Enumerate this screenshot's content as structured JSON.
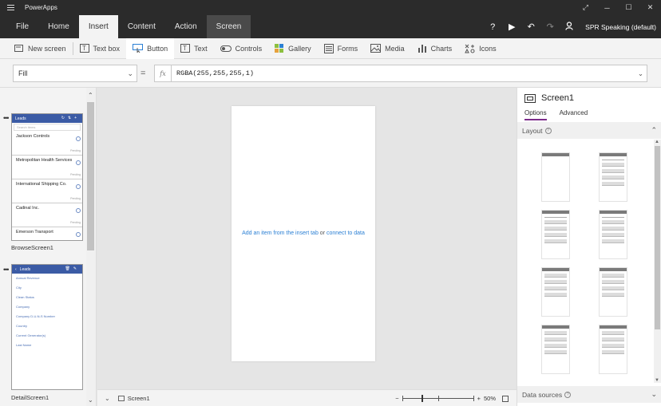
{
  "app": {
    "title": "PowerApps"
  },
  "menu": {
    "tabs": [
      "File",
      "Home",
      "Insert",
      "Content",
      "Action",
      "Screen"
    ],
    "active_tab": "Insert",
    "user": "SPR Speaking (default)"
  },
  "ribbon": {
    "buttons": [
      {
        "label": "New screen",
        "icon": "new-screen-icon"
      },
      {
        "label": "Text box",
        "icon": "text-box-icon"
      },
      {
        "label": "Button",
        "icon": "button-icon"
      },
      {
        "label": "Text",
        "icon": "text-icon"
      },
      {
        "label": "Controls",
        "icon": "toggle-icon"
      },
      {
        "label": "Gallery",
        "icon": "gallery-icon"
      },
      {
        "label": "Forms",
        "icon": "forms-icon"
      },
      {
        "label": "Media",
        "icon": "media-icon"
      },
      {
        "label": "Charts",
        "icon": "charts-icon"
      },
      {
        "label": "Icons",
        "icon": "icons-icon"
      }
    ]
  },
  "formula_bar": {
    "property": "Fill",
    "fx": "fx",
    "equals": "=",
    "formula": "RGBA(255,255,255,1)"
  },
  "screens": {
    "browse": {
      "title": "Leads",
      "search_placeholder": "Search items",
      "rows": [
        "Jackson Controls",
        "Metropolitan Health Services",
        "International Shipping Co.",
        "Cadinal Inc.",
        "Emerson Transport"
      ],
      "status": "Pending",
      "label": "BrowseScreen1"
    },
    "detail": {
      "title": "Leads",
      "fields": [
        "Annual Revenue",
        "City",
        "Clean Status",
        "Company",
        "Company D-U-N-S Number",
        "Country",
        "Current Generator(s)",
        "Last Name"
      ],
      "label": "DetailScreen1"
    }
  },
  "canvas": {
    "hint_insert": "Add an item from the insert tab",
    "hint_or": "or",
    "hint_connect": "connect to data"
  },
  "status_bar": {
    "screen_name": "Screen1",
    "zoom": "50%",
    "minus": "−",
    "plus": "+"
  },
  "right_panel": {
    "title": "Screen1",
    "tabs": [
      "Options",
      "Advanced"
    ],
    "active_tab": "Options",
    "layout_label": "Layout",
    "datasources_label": "Data sources"
  },
  "colors": {
    "titlebar": "#2b2b2b",
    "accent_purple": "#7c2d8a",
    "thumb_header": "#3b5ba5",
    "link": "#2a7fd4"
  }
}
